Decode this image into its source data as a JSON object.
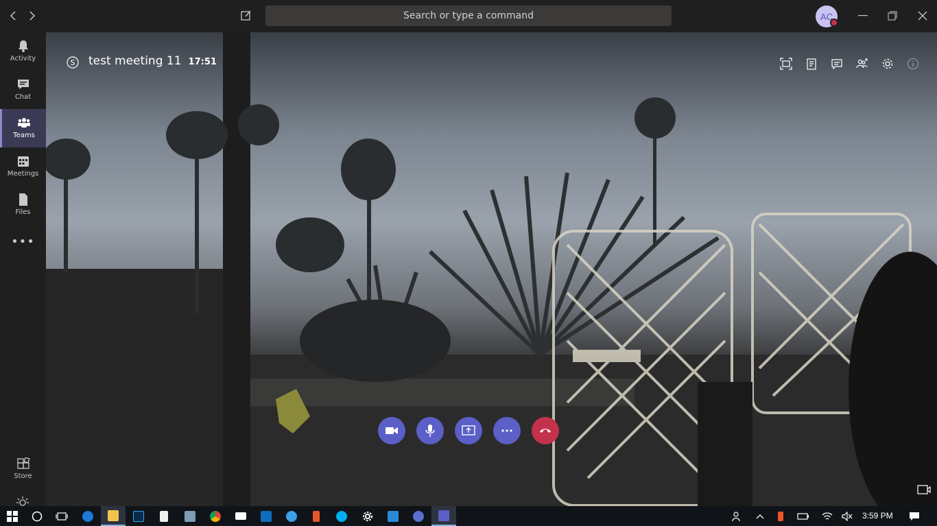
{
  "titlebar": {
    "search_placeholder": "Search or type a command",
    "avatar_initials": "AC"
  },
  "rail": {
    "items": [
      {
        "label": "Activity",
        "icon": "bell-icon"
      },
      {
        "label": "Chat",
        "icon": "chat-icon"
      },
      {
        "label": "Teams",
        "icon": "teams-icon",
        "active": true
      },
      {
        "label": "Meetings",
        "icon": "calendar-icon"
      },
      {
        "label": "Files",
        "icon": "file-icon"
      }
    ],
    "more": "•••",
    "store_label": "Store"
  },
  "meeting": {
    "title": "test meeting 11",
    "duration": "17:51"
  },
  "taskbar": {
    "time": "3:59 PM"
  },
  "colors": {
    "accent": "#5b5fc7",
    "hangup": "#c4314b",
    "rail_active": "#3b3a55"
  }
}
